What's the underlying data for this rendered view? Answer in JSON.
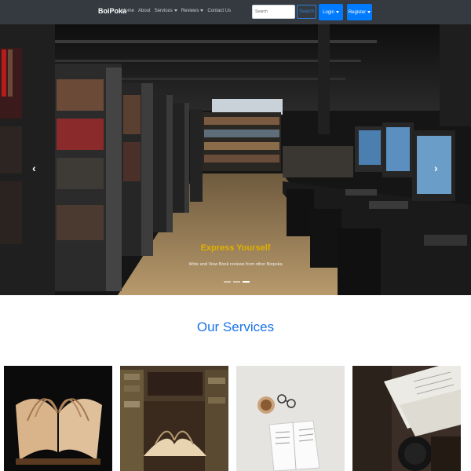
{
  "navbar": {
    "brand": "BoiPoka",
    "links": [
      "Home",
      "About",
      "Services",
      "Reviews",
      "Contact Us"
    ],
    "search_placeholder": "Search",
    "search_button": "Search",
    "login_button": "Login",
    "register_button": "Register"
  },
  "carousel": {
    "prev_icon": "‹",
    "next_icon": "›",
    "caption_title": "Express Yourself",
    "caption_text": "Write and View Book reviews from other Boipoka",
    "indicator_count": 3,
    "active_indicator": 3
  },
  "services": {
    "title": "Our Services"
  },
  "colors": {
    "navbar_bg": "#343a40",
    "primary": "#007bff",
    "caption_title": "#e0b000",
    "services_title": "#1a73e8"
  }
}
